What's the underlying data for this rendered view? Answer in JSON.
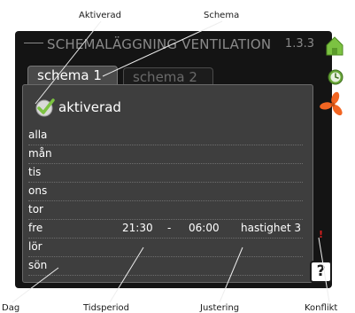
{
  "annotations": {
    "aktiverad": "Aktiverad",
    "schema": "Schema",
    "dag": "Dag",
    "tidsperiod": "Tidsperiod",
    "justering": "Justering",
    "konflikt": "Konflikt"
  },
  "screen": {
    "title": "SCHEMALÄGGNING VENTILATION",
    "menu_number": "1.3.3",
    "tabs": [
      {
        "label": "schema 1",
        "selected": true
      },
      {
        "label": "schema 2",
        "selected": false
      }
    ],
    "activated_label": "aktiverad",
    "activated_checked": true,
    "days": [
      {
        "day": "alla",
        "start": "",
        "sep": "",
        "end": "",
        "adjustment": ""
      },
      {
        "day": "mån",
        "start": "",
        "sep": "",
        "end": "",
        "adjustment": ""
      },
      {
        "day": "tis",
        "start": "",
        "sep": "",
        "end": "",
        "adjustment": ""
      },
      {
        "day": "ons",
        "start": "",
        "sep": "",
        "end": "",
        "adjustment": ""
      },
      {
        "day": "tor",
        "start": "",
        "sep": "",
        "end": "",
        "adjustment": ""
      },
      {
        "day": "fre",
        "start": "21:30",
        "sep": "-",
        "end": "06:00",
        "adjustment": "hastighet 3"
      },
      {
        "day": "lör",
        "start": "",
        "sep": "",
        "end": "",
        "adjustment": ""
      },
      {
        "day": "sön",
        "start": "",
        "sep": "",
        "end": "",
        "adjustment": ""
      }
    ],
    "conflict_mark": "!",
    "help_label": "?",
    "side_icons": [
      "house-icon",
      "clock-icon",
      "fan-icon"
    ],
    "colors": {
      "accent_green": "#7cc242",
      "fan_orange": "#f26522",
      "conflict_red": "#d81e1e"
    }
  }
}
